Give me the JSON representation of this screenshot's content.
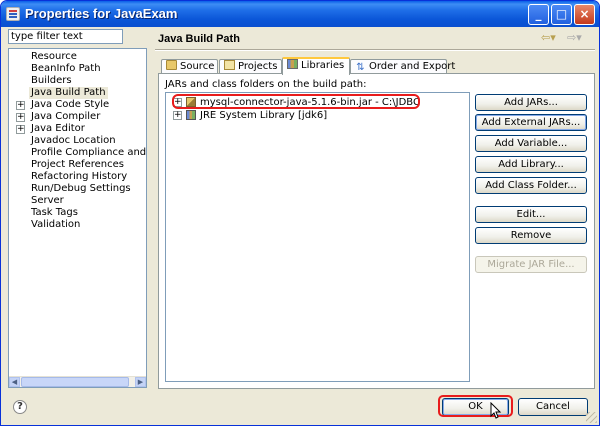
{
  "window": {
    "title": "Properties for JavaExam",
    "controls": {
      "minimize": "_",
      "maximize": "□",
      "close": "×"
    }
  },
  "filter": {
    "value": "type filter text"
  },
  "tree": {
    "items": [
      {
        "label": "Resource",
        "expandable": false
      },
      {
        "label": "BeanInfo Path",
        "expandable": false
      },
      {
        "label": "Builders",
        "expandable": false
      },
      {
        "label": "Java Build Path",
        "expandable": false,
        "selected": true
      },
      {
        "label": "Java Code Style",
        "expandable": true
      },
      {
        "label": "Java Compiler",
        "expandable": true
      },
      {
        "label": "Java Editor",
        "expandable": true
      },
      {
        "label": "Javadoc Location",
        "expandable": false
      },
      {
        "label": "Profile Compliance and Va",
        "expandable": false
      },
      {
        "label": "Project References",
        "expandable": false
      },
      {
        "label": "Refactoring History",
        "expandable": false
      },
      {
        "label": "Run/Debug Settings",
        "expandable": false
      },
      {
        "label": "Server",
        "expandable": false
      },
      {
        "label": "Task Tags",
        "expandable": false
      },
      {
        "label": "Validation",
        "expandable": false
      }
    ]
  },
  "page": {
    "title": "Java Build Path",
    "nav_back": "⇦▾",
    "nav_forward": "⇨▾"
  },
  "tabs": [
    {
      "label": "Source",
      "icon": "source-folder-icon"
    },
    {
      "label": "Projects",
      "icon": "projects-icon"
    },
    {
      "label": "Libraries",
      "icon": "libraries-icon",
      "active": true
    },
    {
      "label": "Order and Export",
      "icon": "order-export-icon"
    }
  ],
  "libraries": {
    "caption": "JARs and class folders on the build path:",
    "entries": [
      {
        "label": "mysql-connector-java-5.1.6-bin.jar - C:\\JDBC",
        "icon": "jar-icon",
        "highlighted": true
      },
      {
        "label": "JRE System Library [jdk6]",
        "icon": "jre-library-icon",
        "highlighted": false
      }
    ]
  },
  "buttons": {
    "add_jars": "Add JARs...",
    "add_external_jars": "Add External JARs...",
    "add_variable": "Add Variable...",
    "add_library": "Add Library...",
    "add_class_folder": "Add Class Folder...",
    "edit": "Edit...",
    "remove": "Remove",
    "migrate_jar": "Migrate JAR File...",
    "ok": "OK",
    "cancel": "Cancel",
    "help": "?"
  },
  "colors": {
    "titlebar": "#0a5fe8",
    "dialog_bg": "#ece9d8",
    "annotation_red": "#e81c1c",
    "active_tab_accent": "#ffc83c"
  }
}
